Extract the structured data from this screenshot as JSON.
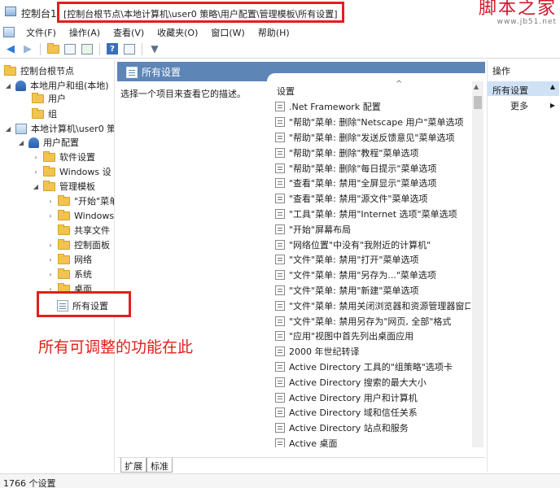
{
  "window": {
    "title": "控制台1",
    "path": "[控制台根节点\\本地计算机\\user0 策略\\用户配置\\管理模板\\所有设置]"
  },
  "watermark": {
    "main": "脚本之家",
    "url": "www.jb51.net"
  },
  "menu": [
    "文件(F)",
    "操作(A)",
    "查看(V)",
    "收藏夹(O)",
    "窗口(W)",
    "帮助(H)"
  ],
  "toolbar": {
    "help_label": "?",
    "back_icon": "back-arrow-icon",
    "forward_icon": "forward-arrow-icon"
  },
  "tree": {
    "root": "控制台根节点",
    "local_users": "本地用户和组(本地)",
    "users": "用户",
    "groups": "组",
    "local_computer": "本地计算机\\user0 策",
    "user_config": "用户配置",
    "software": "软件设置",
    "windows": "Windows 设",
    "admin_templates": "管理模板",
    "start": "\"开始\"菜单",
    "windows_comp": "Windows",
    "shared": "共享文件",
    "control_panel": "控制面板",
    "network": "网络",
    "system": "系统",
    "desktop": "桌面",
    "all_settings": "所有设置"
  },
  "annotation": "所有可调整的功能在此",
  "middle": {
    "header_title": "所有设置",
    "description": "选择一个项目来查看它的描述。",
    "column_header": "设置",
    "items": [
      ".Net Framework 配置",
      "\"帮助\"菜单: 删除\"Netscape 用户\"菜单选项",
      "\"帮助\"菜单: 删除\"发送反馈意见\"菜单选项",
      "\"帮助\"菜单: 删除\"教程\"菜单选项",
      "\"帮助\"菜单: 删除\"每日提示\"菜单选项",
      "\"查看\"菜单: 禁用\"全屏显示\"菜单选项",
      "\"查看\"菜单: 禁用\"源文件\"菜单选项",
      "\"工具\"菜单: 禁用\"Internet 选项\"菜单选项",
      "\"开始\"屏幕布局",
      "\"网络位置\"中没有\"我附近的计算机\"",
      "\"文件\"菜单: 禁用\"打开\"菜单选项",
      "\"文件\"菜单: 禁用\"另存为...\"菜单选项",
      "\"文件\"菜单: 禁用\"新建\"菜单选项",
      "\"文件\"菜单: 禁用关闭浏览器和资源管理器窗口",
      "\"文件\"菜单: 禁用另存为\"网页, 全部\"格式",
      "\"应用\"视图中首先列出桌面应用",
      "2000 年世纪转译",
      "Active Directory 工具的\"组策略\"选项卡",
      "Active Directory 搜索的最大大小",
      "Active Directory 用户和计算机",
      "Active Directory 域和信任关系",
      "Active Directory 站点和服务",
      "Active 桌面"
    ],
    "tabs": [
      "扩展",
      "标准"
    ]
  },
  "actions": {
    "title": "操作",
    "section": "所有设置",
    "more": "更多"
  },
  "status": "1766 个设置",
  "colors": {
    "header_blue": "#5d86b7",
    "highlight_red": "#e0201c",
    "selection": "#cfe1f5"
  }
}
